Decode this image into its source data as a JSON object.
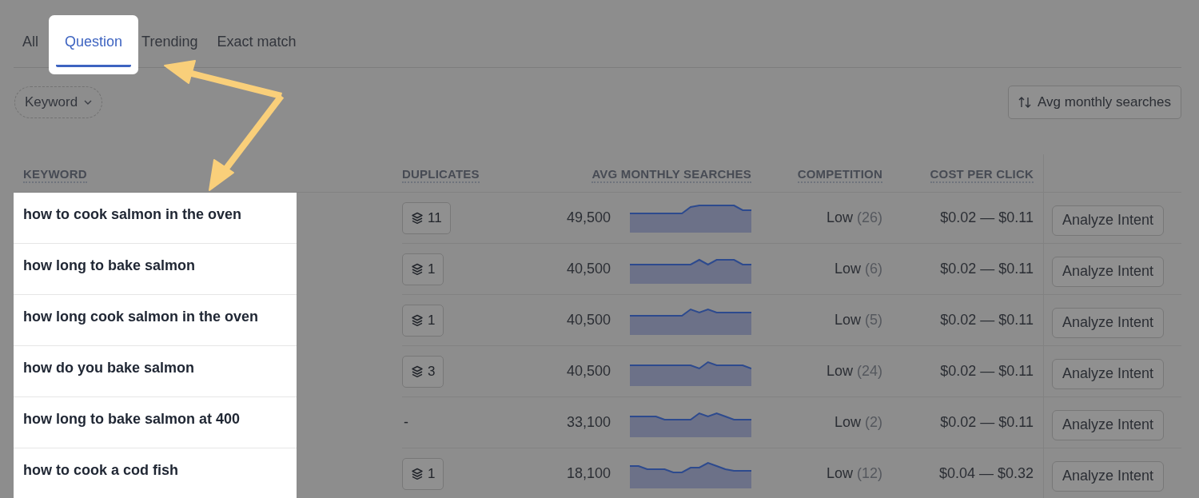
{
  "tabs": [
    {
      "label": "All",
      "selected": false,
      "highlighted": false
    },
    {
      "label": "Question",
      "selected": true,
      "highlighted": true
    },
    {
      "label": "Trending",
      "selected": false,
      "highlighted": false
    },
    {
      "label": "Exact match",
      "selected": false,
      "highlighted": false
    }
  ],
  "filter": {
    "label": "Keyword"
  },
  "sort_button": {
    "label": "Avg monthly searches"
  },
  "table": {
    "keyword_column_highlighted": true,
    "columns": [
      "KEYWORD",
      "DUPLICATES",
      "AVG MONTHLY SEARCHES",
      "COMPETITION",
      "COST PER CLICK"
    ],
    "rows": [
      {
        "keyword": "how to cook salmon in the oven",
        "duplicates": {
          "kind": "badge",
          "text": "11"
        },
        "searches": "49,500",
        "competition": "Low",
        "competition_index": "(26)",
        "cpc": "$0.02 — $0.11",
        "action": "Analyze Intent"
      },
      {
        "keyword": "how long to bake salmon",
        "duplicates": {
          "kind": "badge",
          "text": "1"
        },
        "searches": "40,500",
        "competition": "Low",
        "competition_index": "(6)",
        "cpc": "$0.02 — $0.11",
        "action": "Analyze Intent"
      },
      {
        "keyword": "how long cook salmon in the oven",
        "duplicates": {
          "kind": "badge",
          "text": "1"
        },
        "searches": "40,500",
        "competition": "Low",
        "competition_index": "(5)",
        "cpc": "$0.02 — $0.11",
        "action": "Analyze Intent"
      },
      {
        "keyword": "how do you bake salmon",
        "duplicates": {
          "kind": "badge",
          "text": "3"
        },
        "searches": "40,500",
        "competition": "Low",
        "competition_index": "(24)",
        "cpc": "$0.02 — $0.11",
        "action": "Analyze Intent"
      },
      {
        "keyword": "how long to bake salmon at 400",
        "duplicates": {
          "kind": "none",
          "text": "-"
        },
        "searches": "33,100",
        "competition": "Low",
        "competition_index": "(2)",
        "cpc": "$0.02 — $0.11",
        "action": "Analyze Intent"
      },
      {
        "keyword": "how to cook a cod fish",
        "duplicates": {
          "kind": "badge",
          "text": "1"
        },
        "searches": "18,100",
        "competition": "Low",
        "competition_index": "(12)",
        "cpc": "$0.04 — $0.32",
        "action": "Analyze Intent"
      }
    ]
  }
}
